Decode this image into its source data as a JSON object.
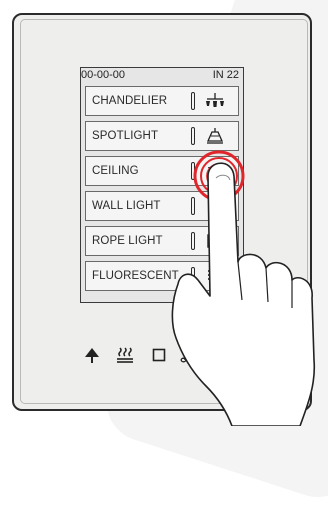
{
  "screen": {
    "status_left": "00-00-00",
    "status_right": "IN 22",
    "items": [
      {
        "label": "CHANDELIER",
        "icon": "chandelier-icon"
      },
      {
        "label": "SPOTLIGHT",
        "icon": "spotlight-icon"
      },
      {
        "label": "CEILING",
        "icon": "ceiling-light-icon"
      },
      {
        "label": "WALL LIGHT",
        "icon": "wall-light-icon"
      },
      {
        "label": "ROPE LIGHT",
        "icon": "rope-light-icon"
      },
      {
        "label": "FLUORESCENT",
        "icon": "fluorescent-icon"
      }
    ]
  },
  "bottom_bar": {
    "icons": [
      "lamp-icon",
      "heating-icon",
      "window-icon",
      "music-icon"
    ]
  },
  "colors": {
    "touch_ring": "#e0262b",
    "panel_border": "#2b2b2b",
    "screen_bg": "#e6e6e6"
  }
}
